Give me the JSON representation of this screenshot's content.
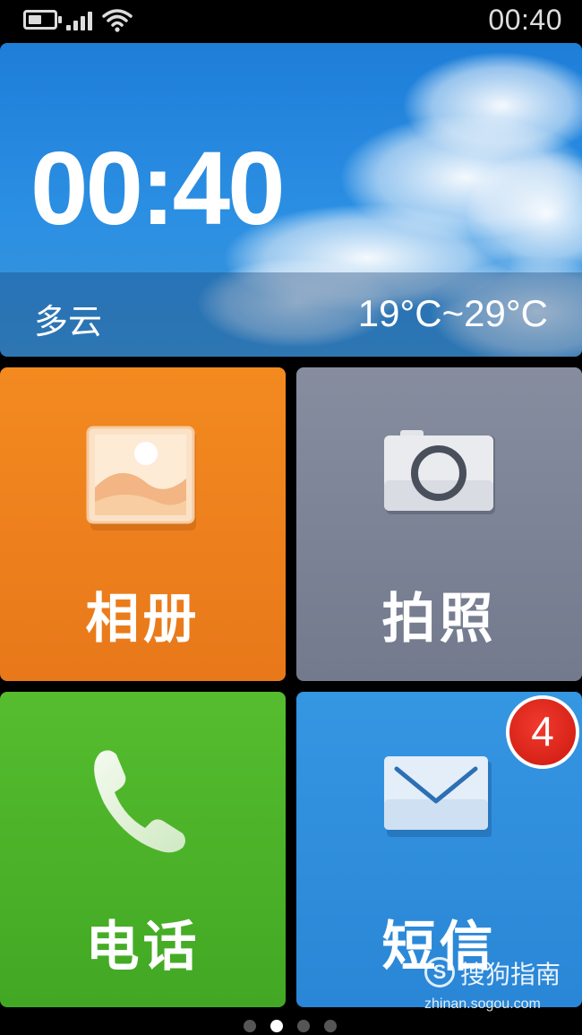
{
  "status_bar": {
    "time": "00:40",
    "icons": [
      "battery-icon",
      "signal-icon",
      "wifi-icon"
    ]
  },
  "weather_widget": {
    "clock": "00:40",
    "condition": "多云",
    "temperature": "19°C~29°C"
  },
  "tiles": [
    {
      "label": "相册",
      "icon": "gallery-icon",
      "color": "#f08020"
    },
    {
      "label": "拍照",
      "icon": "camera-icon",
      "color": "#7c8396"
    },
    {
      "label": "电话",
      "icon": "phone-icon",
      "color": "#4cb52a"
    },
    {
      "label": "短信",
      "icon": "mail-icon",
      "color": "#2f8edc",
      "badge": "4"
    }
  ],
  "pager": {
    "pages": 4,
    "active_index": 1
  },
  "watermark": {
    "title": "搜狗指南",
    "url": "zhinan.sogou.com"
  }
}
